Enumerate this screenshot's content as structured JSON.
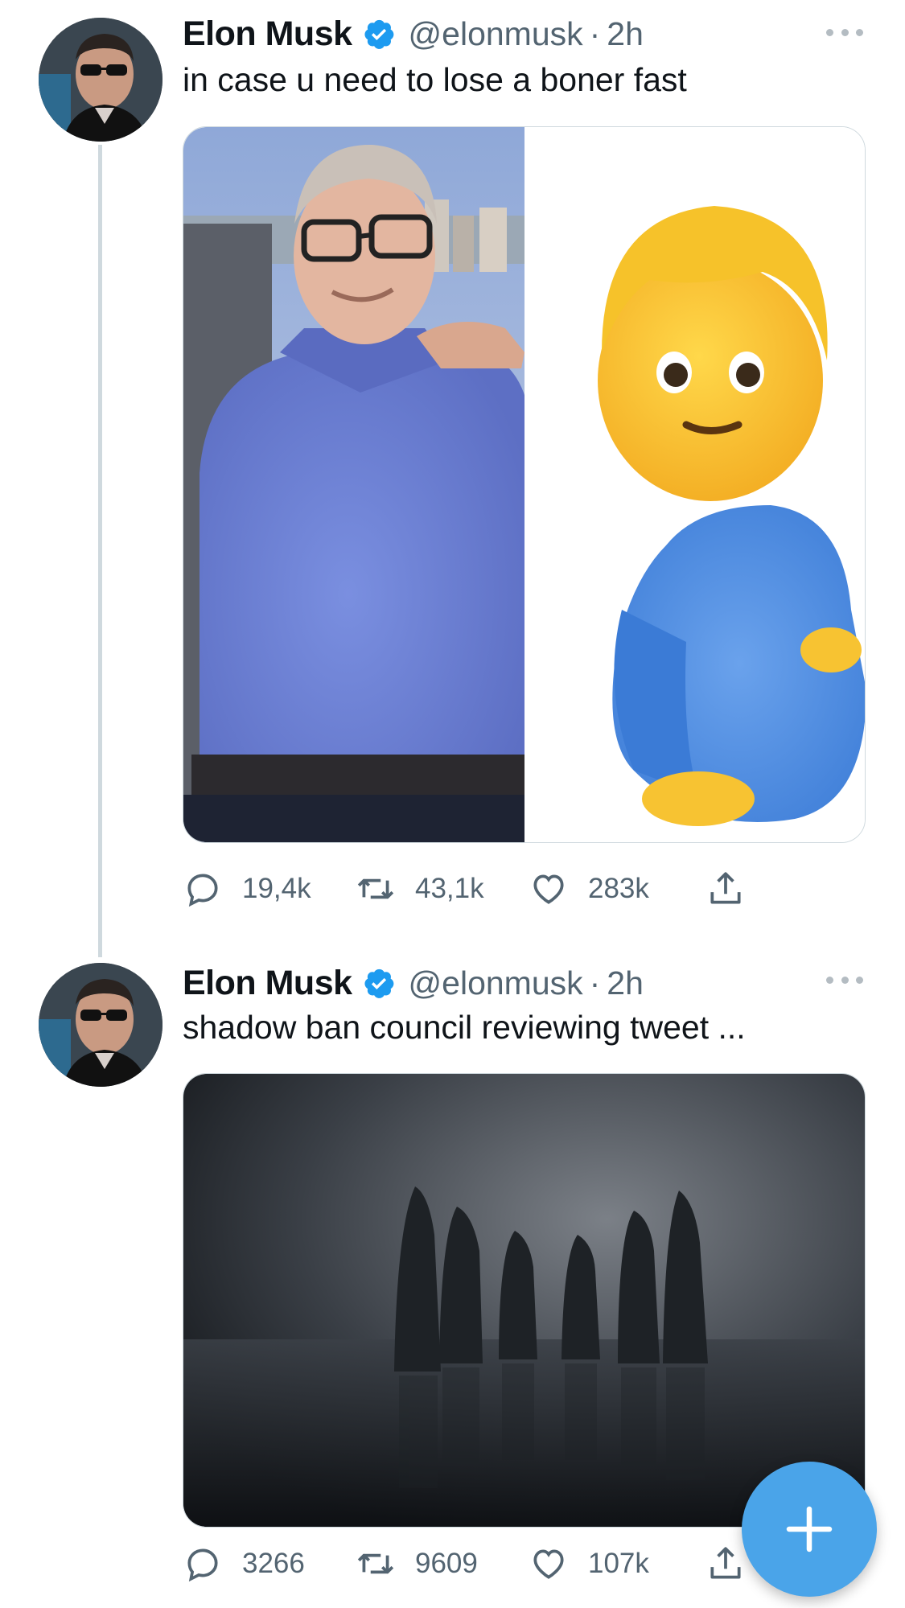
{
  "tweets": [
    {
      "author_name": "Elon Musk",
      "handle": "@elonmusk",
      "separator": "·",
      "time": "2h",
      "text": "in case u need to lose a boner fast",
      "media_icon": "side-by-side-photo-man-and-pregnant-man-emoji",
      "replies": "19,4k",
      "retweets": "43,1k",
      "likes": "283k"
    },
    {
      "author_name": "Elon Musk",
      "handle": "@elonmusk",
      "separator": "·",
      "time": "2h",
      "text": "shadow ban council reviewing tweet ...",
      "media_icon": "photo-hooded-statues-on-water",
      "replies": "3266",
      "retweets": "9609",
      "likes": "107k"
    }
  ],
  "colors": {
    "accent": "#1d9bf0",
    "fab": "#4aa4e9",
    "secondary_text": "#536471",
    "thread_line": "#cfd9de"
  },
  "icons": {
    "reply": "reply-icon",
    "retweet": "retweet-icon",
    "like": "heart-icon",
    "share": "share-icon",
    "fab": "plus-icon",
    "verified": "verified-badge-icon"
  }
}
